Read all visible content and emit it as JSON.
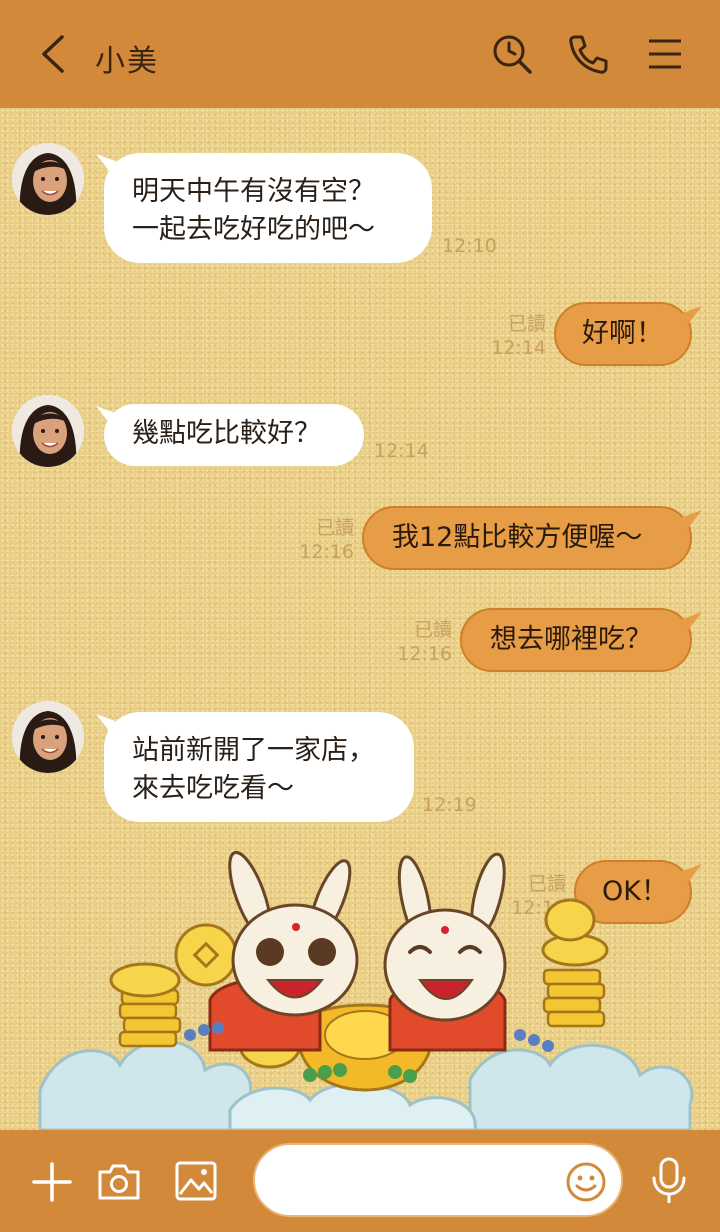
{
  "header": {
    "contact_name": "小美",
    "icons": [
      "back-icon",
      "search-icon",
      "phone-icon",
      "menu-icon"
    ]
  },
  "messages": [
    {
      "side": "left",
      "lines": [
        "明天中午有沒有空？",
        "一起去吃好吃的吧～"
      ],
      "time": "12:10"
    },
    {
      "side": "right",
      "text": "好啊！",
      "read": "已讀",
      "time": "12:14"
    },
    {
      "side": "left",
      "lines": [
        "幾點吃比較好？"
      ],
      "time": "12:14"
    },
    {
      "side": "right",
      "text": "我12點比較方便喔～",
      "read": "已讀",
      "time": "12:16"
    },
    {
      "side": "right",
      "text": "想去哪裡吃？",
      "read": "已讀",
      "time": "12:16"
    },
    {
      "side": "left",
      "lines": [
        "站前新開了一家店，",
        "來去吃吃看～"
      ],
      "time": "12:19"
    },
    {
      "side": "right",
      "text": "OK！",
      "read": "已讀",
      "time": "12:19"
    }
  ],
  "footer": {
    "input_value": "",
    "icons": [
      "plus-icon",
      "camera-icon",
      "image-icon",
      "emoji-icon",
      "microphone-icon"
    ]
  },
  "colors": {
    "bar": "#d28a3a",
    "outgoing_bubble": "#e79d45",
    "incoming_bubble": "#ffffff",
    "meta_text": "#c8a060"
  }
}
